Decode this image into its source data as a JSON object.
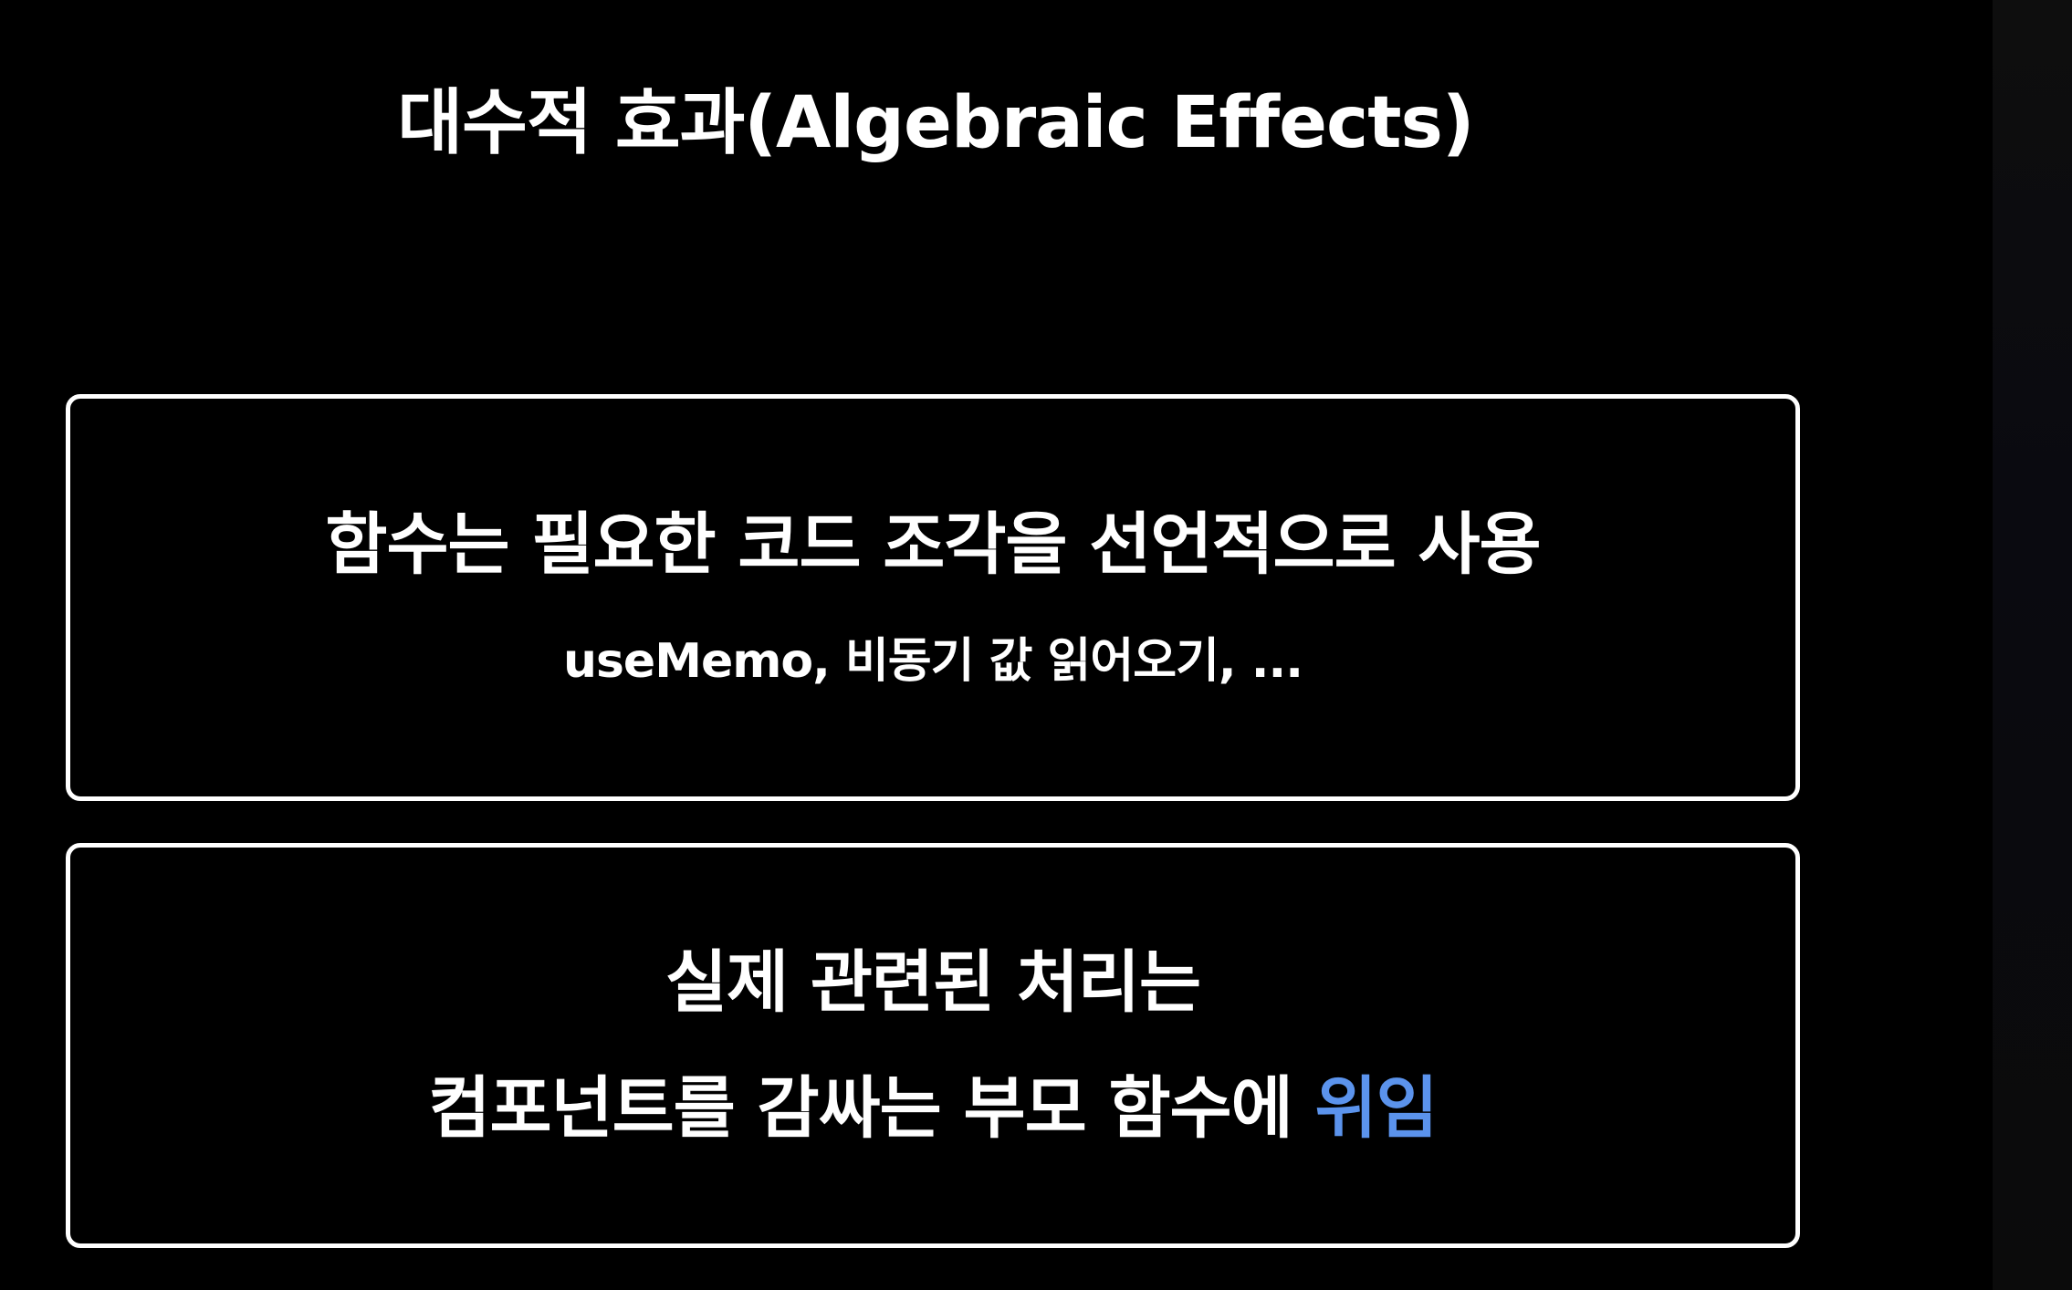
{
  "slide": {
    "title": "대수적 효과(Algebraic Effects)",
    "box1": {
      "main": "함수는 필요한 코드 조각을 선언적으로 사용",
      "sub": "useMemo, 비동기 값 읽어오기, ..."
    },
    "box2": {
      "line1": "실제 관련된 처리는",
      "line2_prefix": "컴포넌트를 감싸는 부모 함수에 ",
      "line2_highlight": "위임"
    }
  },
  "colors": {
    "background": "#000000",
    "text": "#ffffff",
    "highlight": "#5b93ec"
  }
}
